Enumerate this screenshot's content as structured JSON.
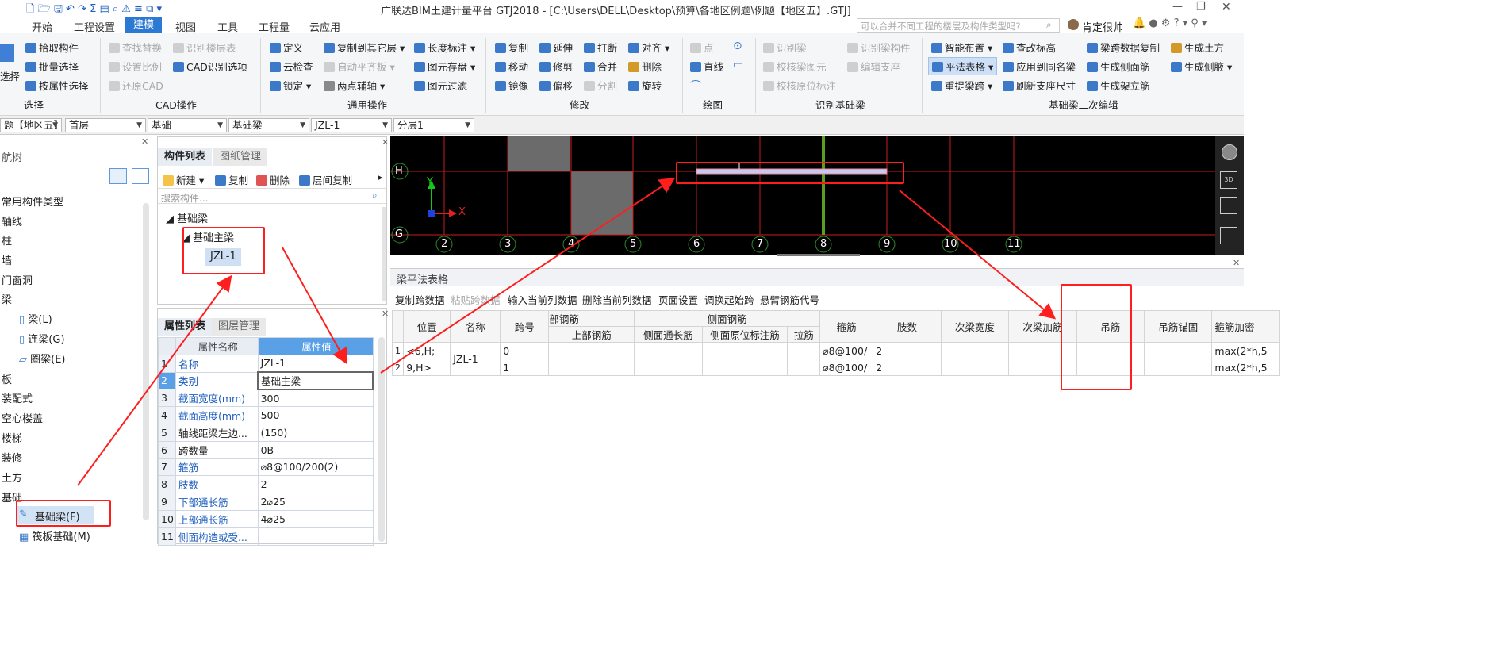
{
  "title_bar": {
    "title": "广联达BIM土建计量平台 GTJ2018 - [C:\\Users\\DELL\\Desktop\\预算\\各地区例题\\例题【地区五】.GTJ]"
  },
  "menu_tabs": [
    "开始",
    "工程设置",
    "建模",
    "视图",
    "工具",
    "工程量",
    "云应用"
  ],
  "active_tab": "建模",
  "search": {
    "placeholder": "可以合并不同工程的楼层及构件类型吗?"
  },
  "user": {
    "name": "肯定很帅"
  },
  "ribbon": {
    "select": {
      "items": [
        "拾取构件",
        "批量选择",
        "按属性选择"
      ],
      "big": "选择",
      "group": "选择"
    },
    "cad": {
      "items": [
        "查找替换",
        "设置比例",
        "还原CAD",
        "识别楼层表",
        "CAD识别选项"
      ],
      "group": "CAD操作"
    },
    "general": {
      "items": [
        "定义",
        "云检查",
        "锁定",
        "复制到其它层",
        "自动平齐板",
        "两点辅轴",
        "长度标注",
        "图元存盘",
        "图元过滤"
      ],
      "group": "通用操作"
    },
    "modify": {
      "items": [
        "复制",
        "移动",
        "镜像",
        "延伸",
        "修剪",
        "偏移",
        "打断",
        "合并",
        "分割",
        "对齐",
        "删除",
        "旋转"
      ],
      "group": "修改"
    },
    "draw": {
      "items": [
        "点",
        "直线"
      ],
      "group": "绘图"
    },
    "identify": {
      "items": [
        "识别梁",
        "校核梁图元",
        "校核原位标注",
        "识别梁构件",
        "编辑支座"
      ],
      "group": "识别基础梁"
    },
    "secondary": {
      "items": [
        "智能布置",
        "平法表格",
        "重提梁跨",
        "查改标高",
        "应用到同名梁",
        "刷新支座尺寸",
        "梁跨数据复制",
        "生成侧面筋",
        "生成架立筋",
        "生成土方",
        "生成侧腋"
      ],
      "group": "基础梁二次编辑"
    }
  },
  "combos": [
    "题【地区五】",
    "首层",
    "基础",
    "基础梁",
    "JZL-1",
    "分层1"
  ],
  "nav": {
    "title": "航树",
    "items": [
      "常用构件类型",
      "轴线",
      "柱",
      "墙",
      "门窗洞",
      "梁",
      "梁(L)",
      "连梁(G)",
      "圈梁(E)",
      "板",
      "装配式",
      "空心楼盖",
      "楼梯",
      "装修",
      "土方",
      "基础",
      "基础梁(F)",
      "筏板基础(M)"
    ]
  },
  "component_list": {
    "tabs": [
      "构件列表",
      "图纸管理"
    ],
    "toolbar": [
      "新建",
      "复制",
      "删除",
      "层间复制"
    ],
    "search_placeholder": "搜索构件...",
    "tree": {
      "root": "基础梁",
      "child": "基础主梁",
      "leaf": "JZL-1"
    }
  },
  "properties": {
    "tabs": [
      "属性列表",
      "图层管理"
    ],
    "headers": [
      "属性名称",
      "属性值"
    ],
    "rows": [
      {
        "n": "1",
        "name": "名称",
        "value": "JZL-1"
      },
      {
        "n": "2",
        "name": "类别",
        "value": "基础主梁"
      },
      {
        "n": "3",
        "name": "截面宽度(mm)",
        "value": "300"
      },
      {
        "n": "4",
        "name": "截面高度(mm)",
        "value": "500"
      },
      {
        "n": "5",
        "name": "轴线距梁左边...",
        "value": "(150)"
      },
      {
        "n": "6",
        "name": "跨数量",
        "value": "0B"
      },
      {
        "n": "7",
        "name": "箍筋",
        "value": "⌀8@100/200(2)"
      },
      {
        "n": "8",
        "name": "肢数",
        "value": "2"
      },
      {
        "n": "9",
        "name": "下部通长筋",
        "value": "2⌀25"
      },
      {
        "n": "10",
        "name": "上部通长筋",
        "value": "4⌀25"
      },
      {
        "n": "11",
        "name": "侧面构造或受...",
        "value": ""
      }
    ]
  },
  "canvas": {
    "row_labels": [
      "H",
      "G"
    ],
    "axis_numbers": [
      "2",
      "3",
      "4",
      "5",
      "6",
      "7",
      "8",
      "9",
      "10",
      "11"
    ],
    "axis_x_label": "X",
    "axis_y_label": "Y"
  },
  "beam_table": {
    "title": "梁平法表格",
    "toolbar": [
      "复制跨数据",
      "粘贴跨数据",
      "输入当前列数据",
      "删除当前列数据",
      "页面设置",
      "调换起始跨",
      "悬臂钢筋代号"
    ],
    "headers": {
      "position": "位置",
      "name": "名称",
      "span": "跨号",
      "top_group": "部钢筋",
      "top_bar": "上部钢筋",
      "side_group": "侧面钢筋",
      "side_through": "侧面通长筋",
      "side_in_situ": "侧面原位标注筋",
      "tie": "拉筋",
      "stirrup": "箍筋",
      "legs": "肢数",
      "sec_width": "次梁宽度",
      "sec_add": "次梁加筋",
      "hanger": "吊筋",
      "hanger_anchor": "吊筋锚固",
      "stirrup_add": "箍筋加密"
    },
    "rows": [
      {
        "idx": "1",
        "pos": "<6,H;",
        "name": "JZL-1",
        "span": "0",
        "stirrup": "⌀8@100/",
        "legs": "2",
        "dense": "max(2*h,5"
      },
      {
        "idx": "2",
        "pos": "9,H>",
        "name": "",
        "span": "1",
        "stirrup": "⌀8@100/",
        "legs": "2",
        "dense": "max(2*h,5"
      }
    ]
  },
  "colors": {
    "accent": "#2b79d3",
    "annotation": "#ff1e1e",
    "canvas_bg": "#000000",
    "grid_red": "#c81e1e",
    "grid_green": "#5b9d1e",
    "property_highlight": "#5aa0e6"
  }
}
